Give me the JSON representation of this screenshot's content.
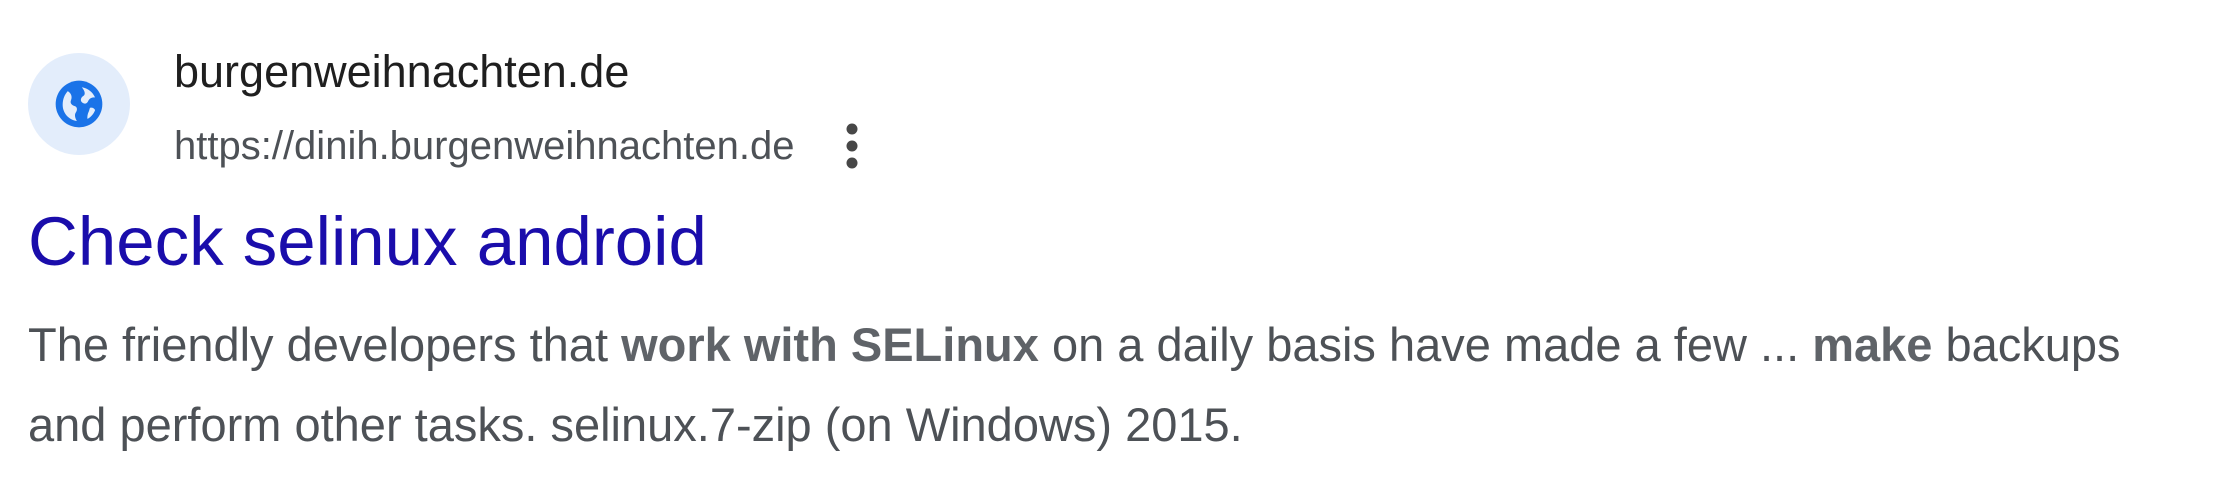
{
  "site": {
    "name": "burgenweihnachten.de",
    "url": "https://dinih.burgenweihnachten.de",
    "favicon_icon": "globe-icon",
    "menu_icon": "more-vert-icon"
  },
  "result": {
    "title": "Check selinux android",
    "snippet": {
      "part1": "The friendly developers that ",
      "bold1": "work with SELinux",
      "part2": " on a daily basis have made a few ... ",
      "bold2": "make",
      "part3": " backups and perform other tasks. selinux.7-zip (on Windows) 2015."
    }
  },
  "colors": {
    "title_link": "#1a0dab",
    "snippet_text": "#4d5156",
    "favicon_bg": "#e3edfb",
    "favicon_globe": "#1a73e8"
  }
}
